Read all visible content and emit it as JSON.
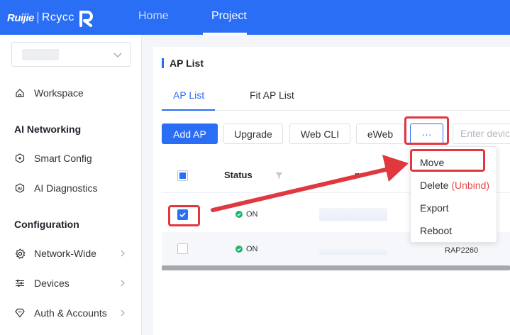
{
  "header": {
    "logo_brand": "Ruijie",
    "logo_product": "Rcycc",
    "nav": [
      {
        "label": "Home"
      },
      {
        "label": "Project"
      }
    ]
  },
  "sidebar": {
    "items": [
      {
        "label": "Workspace",
        "icon": "home-icon"
      },
      {
        "section": "AI Networking"
      },
      {
        "label": "Smart Config",
        "icon": "hexagon-icon"
      },
      {
        "label": "AI Diagnostics",
        "icon": "ai-hexagon-icon"
      },
      {
        "section": "Configuration"
      },
      {
        "label": "Network-Wide",
        "icon": "gear-icon"
      },
      {
        "label": "Devices",
        "icon": "sliders-icon"
      },
      {
        "label": "Auth & Accounts",
        "icon": "shield-heart-icon"
      }
    ]
  },
  "main": {
    "title": "AP List",
    "tabs": [
      {
        "label": "AP List",
        "active": true
      },
      {
        "label": "Fit AP List",
        "active": false
      }
    ],
    "toolbar": {
      "add_label": "Add AP",
      "upgrade_label": "Upgrade",
      "webcli_label": "Web CLI",
      "eweb_label": "eWeb",
      "more_label": "···",
      "search_placeholder": "Enter devic"
    },
    "table": {
      "headers": {
        "status": "Status",
        "partial": "n"
      },
      "rows": [
        {
          "checked": true,
          "status": "ON",
          "model": ""
        },
        {
          "checked": false,
          "status": "ON",
          "model": "RAP2260"
        }
      ]
    },
    "more_menu": {
      "move": "Move",
      "delete": "Delete",
      "unbind": "(Unbind)",
      "export": "Export",
      "reboot": "Reboot"
    }
  },
  "colors": {
    "accent": "#2a6ef5",
    "annotation": "#e0383e",
    "status_on": "#23b26d"
  }
}
